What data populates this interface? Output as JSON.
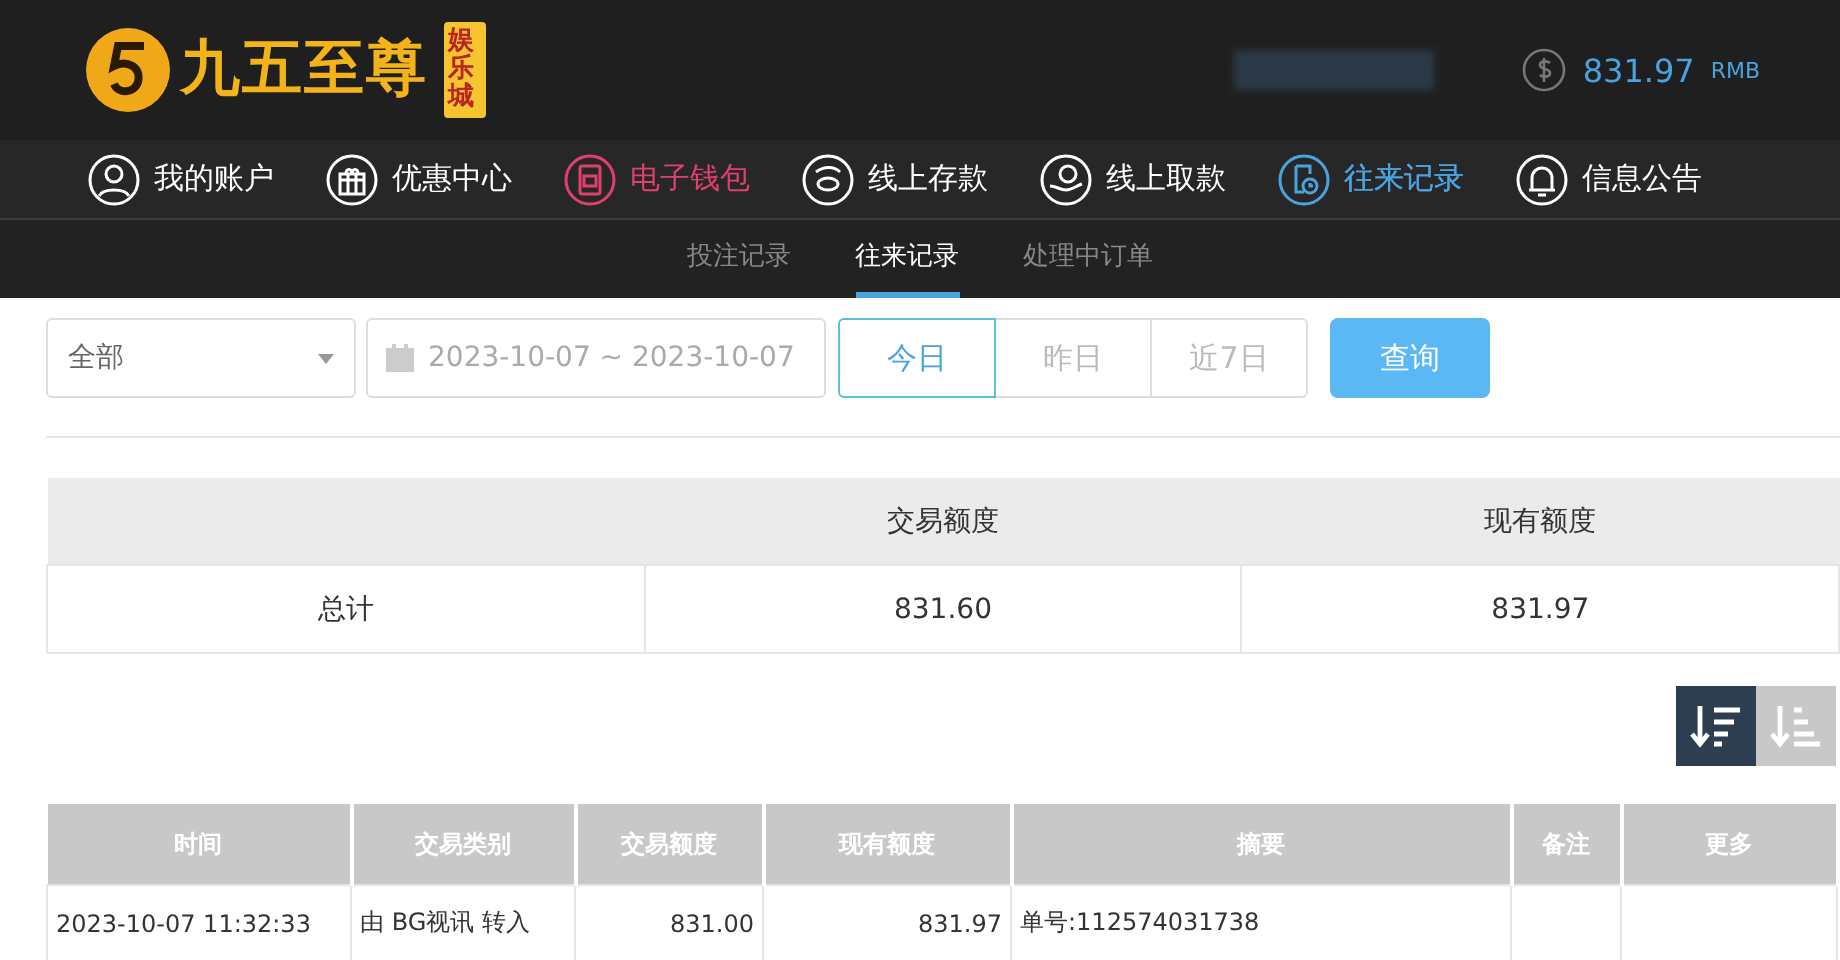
{
  "brand": {
    "name": "九五至尊",
    "badge": "娱乐城"
  },
  "balance": {
    "amount": "831.97",
    "currency": "RMB"
  },
  "nav": [
    {
      "label": "我的账户",
      "color": "#ffffff",
      "selected": false
    },
    {
      "label": "优惠中心",
      "color": "#ffffff",
      "selected": false
    },
    {
      "label": "电子钱包",
      "color": "#e0406e",
      "selected": false
    },
    {
      "label": "线上存款",
      "color": "#ffffff",
      "selected": false
    },
    {
      "label": "线上取款",
      "color": "#ffffff",
      "selected": false
    },
    {
      "label": "往来记录",
      "color": "#4aa3df",
      "selected": true
    },
    {
      "label": "信息公告",
      "color": "#ffffff",
      "selected": false
    }
  ],
  "sub_tabs": [
    {
      "label": "投注记录",
      "selected": false
    },
    {
      "label": "往来记录",
      "selected": true
    },
    {
      "label": "处理中订单",
      "selected": false
    }
  ],
  "filter": {
    "type_select": "全部",
    "date_range": "2023-10-07 ~ 2023-10-07",
    "quick_ranges": [
      {
        "label": "今日",
        "selected": true
      },
      {
        "label": "昨日",
        "selected": false
      },
      {
        "label": "近7日",
        "selected": false
      }
    ],
    "query_button": "查询"
  },
  "summary": {
    "columns": [
      "交易额度",
      "现有额度"
    ],
    "row": [
      "总计",
      "831.60",
      "831.97"
    ]
  },
  "sort_buttons": [
    {
      "selected": true
    },
    {
      "selected": false
    }
  ],
  "table": {
    "columns": [
      "时间",
      "交易类别",
      "交易额度",
      "现有额度",
      "摘要",
      "备注",
      "更多"
    ],
    "rows": [
      [
        "2023-10-07 11:32:33",
        "由 BG视讯 转入",
        "831.00",
        "831.97",
        "单号:112574031738",
        "",
        ""
      ]
    ]
  }
}
